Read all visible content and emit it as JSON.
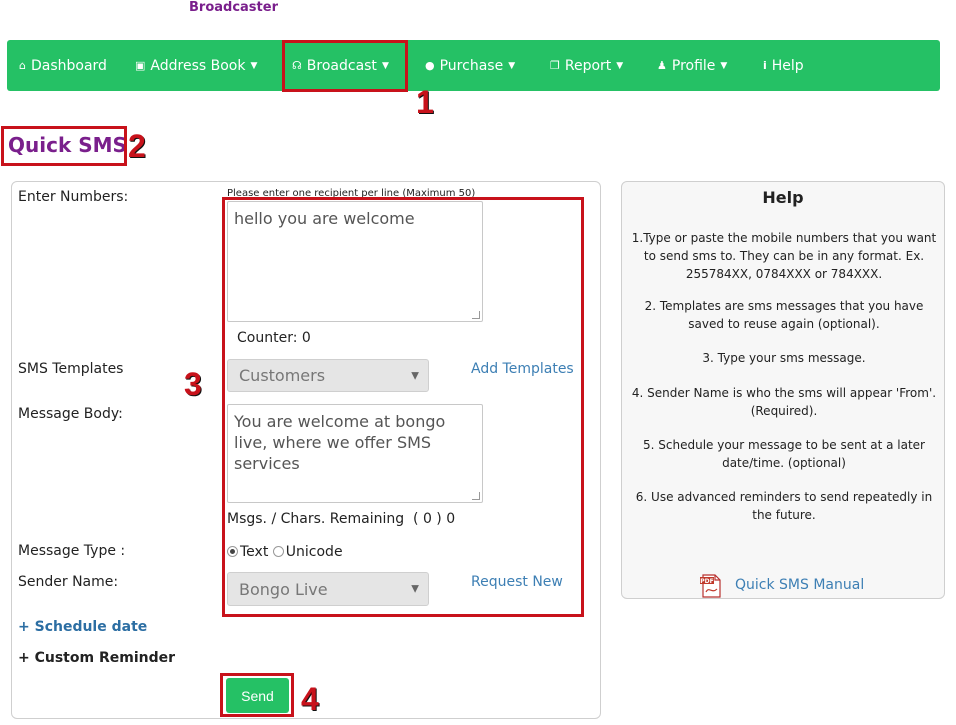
{
  "brand": "Broadcaster",
  "nav": {
    "dashboard": "Dashboard",
    "address_book": "Address Book",
    "broadcast": "Broadcast",
    "purchase": "Purchase",
    "report": "Report",
    "profile": "Profile",
    "help": "Help"
  },
  "annotations": {
    "n1": "1",
    "n2": "2",
    "n3": "3",
    "n4": "4"
  },
  "page_title": "Quick SMS",
  "form": {
    "enter_numbers_label": "Enter Numbers:",
    "numbers_hint": "Please enter one recipient per line (Maximum 50)",
    "numbers_value": "hello you are welcome",
    "counter_text": "Counter: 0",
    "templates_label": "SMS Templates",
    "templates_selected": "Customers",
    "add_templates": "Add Templates",
    "message_body_label": "Message Body:",
    "message_body_value": "You are welcome at bongo live, where we offer SMS services",
    "remaining_text": "Msgs. / Chars. Remaining  ( 0 ) 0",
    "message_type_label": "Message Type :",
    "type_text": "Text",
    "type_unicode": "Unicode",
    "sender_label": "Sender Name:",
    "sender_selected": "Bongo Live",
    "request_new": "Request New",
    "schedule_date": "+ Schedule date",
    "custom_reminder": "+ Custom Reminder",
    "send": "Send"
  },
  "help": {
    "title": "Help",
    "p1": "1.Type or paste the mobile numbers that you want to send sms to. They can be in any format. Ex. 255784XX, 0784XXX or 784XXX.",
    "p2": "2. Templates are sms messages that you have saved to reuse again (optional).",
    "p3": "3. Type your sms message.",
    "p4": "4. Sender Name is who the sms will appear 'From'. (Required).",
    "p5": "5. Schedule your message to be sent at a later date/time. (optional)",
    "p6": "6. Use advanced reminders to send repeatedly in the future.",
    "manual_link": "Quick SMS Manual",
    "pdf_icon_label": "PDF"
  },
  "colors": {
    "nav_green": "#25c165",
    "brand_purple": "#7a1f8c",
    "annotation_red": "#c8121b",
    "link_blue": "#3d7fb4"
  },
  "icons": {
    "dashboard": "home-icon",
    "address_book": "book-icon",
    "broadcast": "broadcast-icon",
    "purchase": "plus-circle-icon",
    "report": "copy-icon",
    "profile": "user-icon",
    "help": "info-icon"
  }
}
